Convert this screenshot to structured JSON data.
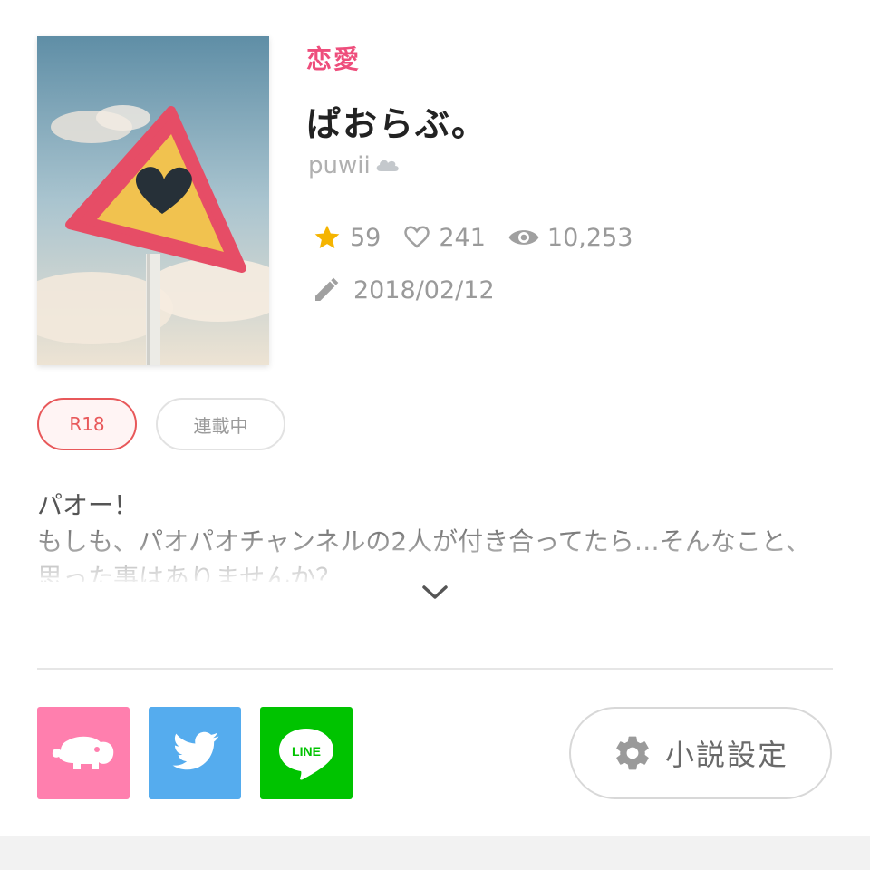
{
  "novel": {
    "genre": "恋愛",
    "title": "ぱおらぶ。",
    "author": "puwii",
    "author_badge_icon": "cloud-icon"
  },
  "stats": {
    "stars": "59",
    "likes": "241",
    "views": "10,253",
    "updated": "2018/02/12"
  },
  "tags": {
    "rating": "R18",
    "status": "連載中"
  },
  "description": {
    "line1": "パオー！",
    "line2": "もしも、パオパオチャンネルの2人が付き合ってたら…そんなこと、思った事はありませんか？"
  },
  "share": {
    "line_label": "LINE"
  },
  "settings": {
    "label": "小説設定"
  },
  "colors": {
    "genre": "#ee4e7c",
    "star": "#f5b400",
    "r18": "#e8585a",
    "estar": "#ff7fae",
    "twitter": "#55acee",
    "line": "#00c300"
  }
}
